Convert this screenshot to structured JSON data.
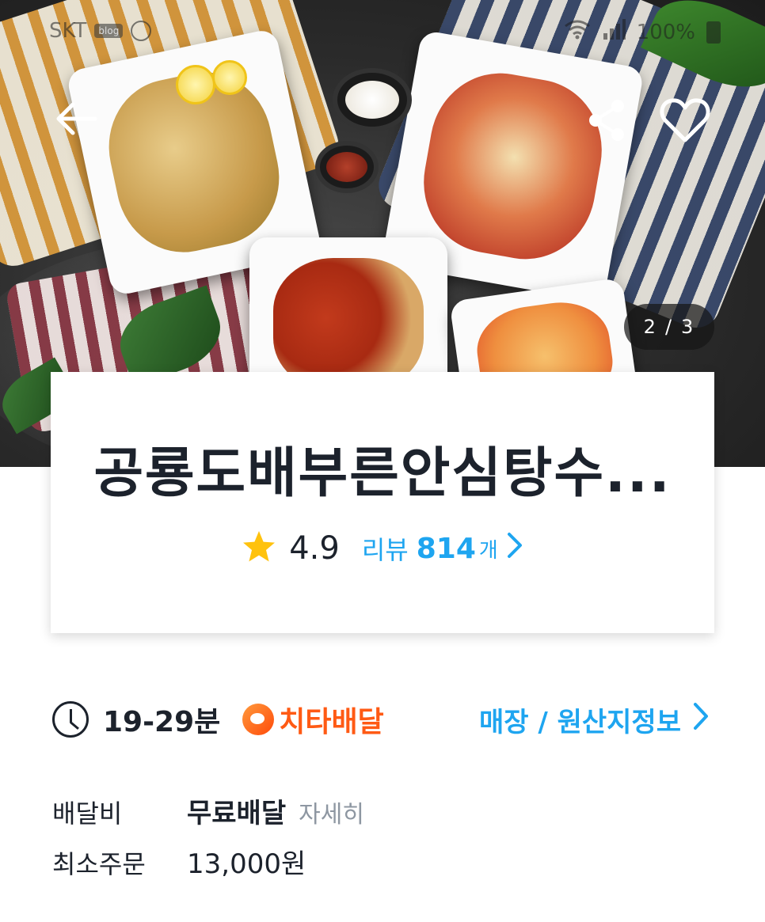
{
  "status_bar": {
    "carrier": "SKT",
    "battery": "100%"
  },
  "hero": {
    "pager": {
      "current": "2",
      "separator": "/",
      "total": "3"
    },
    "icons": {
      "back": "back-arrow-icon",
      "share": "share-icon",
      "favorite": "heart-icon"
    }
  },
  "store": {
    "name": "공룡도배부른안심탕수...",
    "rating": "4.9",
    "review_label": "리뷰",
    "review_count": "814",
    "review_unit": "개"
  },
  "delivery": {
    "time": "19-29분",
    "service_name": "치타배달",
    "store_info_link": "매장 / 원산지정보"
  },
  "fees": {
    "delivery_fee_label": "배달비",
    "delivery_fee_value": "무료배달",
    "detail_link": "자세히",
    "min_order_label": "최소주문",
    "min_order_value": "13,000원"
  },
  "colors": {
    "accent_blue": "#1ea5f0",
    "cheetah_orange": "#ff5a14",
    "star_yellow": "#ffc20e",
    "text_dark": "#1c222c",
    "muted_gray": "#8e97a2"
  }
}
